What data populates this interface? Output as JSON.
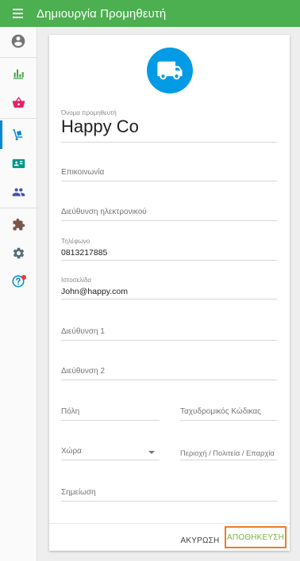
{
  "appbar": {
    "title": "Δημιουργία Προμηθευτή",
    "menu_icon": "hamburger-menu-icon"
  },
  "sidebar": {
    "items": [
      {
        "icon": "account-circle-icon",
        "color": "#757575"
      },
      {
        "icon": "bar-chart-icon",
        "color": "#43a047"
      },
      {
        "icon": "shopping-basket-icon",
        "color": "#e91e63"
      },
      {
        "icon": "hand-truck-icon",
        "color": "#0288d1",
        "active": true
      },
      {
        "icon": "contact-card-icon",
        "color": "#009688"
      },
      {
        "icon": "people-icon",
        "color": "#3f51b5"
      },
      {
        "icon": "puzzle-icon",
        "color": "#795548"
      },
      {
        "icon": "settings-gear-icon",
        "color": "#546e7a"
      },
      {
        "icon": "help-icon",
        "color": "#0288d1",
        "badge_color": "#e53935"
      }
    ]
  },
  "header_icon": {
    "icon": "truck-icon",
    "color": "#039be5"
  },
  "form": {
    "name": {
      "label": "Όνομα προμηθευτή",
      "value": "Happy Co"
    },
    "contact": {
      "placeholder": "Επικοινωνία"
    },
    "email": {
      "placeholder": "Διεύθυνση ηλεκτρονικού"
    },
    "phone": {
      "label": "Τηλέφωνο",
      "value": "0813217885"
    },
    "website": {
      "label": "Ιστοσελίδα",
      "value": "John@happy.com"
    },
    "address1": {
      "placeholder": "Διεύθυνση 1"
    },
    "address2": {
      "placeholder": "Διεύθυνση 2"
    },
    "city": {
      "placeholder": "Πόλη"
    },
    "postal_code": {
      "placeholder": "Ταχυδρομικός Κώδικας"
    },
    "country": {
      "placeholder": "Χώρα"
    },
    "region": {
      "placeholder": "Περιοχή / Πολιτεία / Επαρχία"
    },
    "note": {
      "placeholder": "Σημείωση"
    }
  },
  "actions": {
    "cancel_label": "ΑΚΥΡΩΣΗ",
    "save_label": "ΑΠΟΘΗΚΕΥΣΗ"
  }
}
